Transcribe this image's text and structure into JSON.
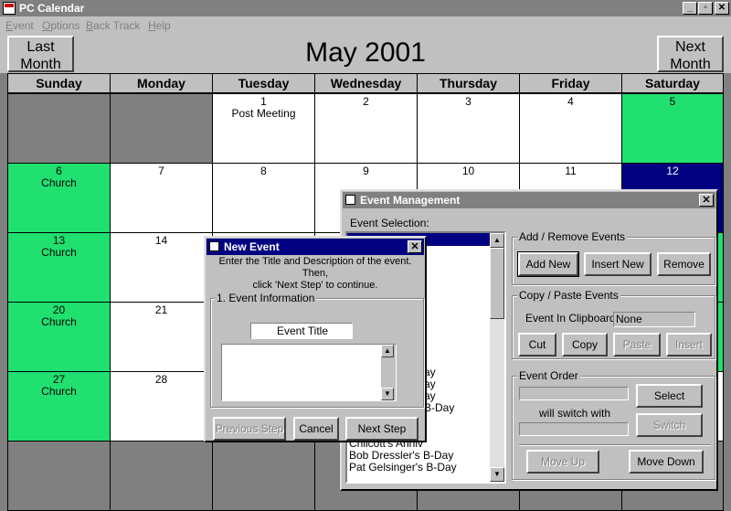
{
  "app": {
    "title": "PC Calendar"
  },
  "window_controls": [
    "_",
    "▫",
    "✕"
  ],
  "menu": [
    "Event",
    "Options",
    "Back Track",
    "Help"
  ],
  "header": {
    "prev_line1": "Last",
    "prev_line2": "Month",
    "next_line1": "Next",
    "next_line2": "Month",
    "month_title": "May 2001"
  },
  "days": [
    "Sunday",
    "Monday",
    "Tuesday",
    "Wednesday",
    "Thursday",
    "Friday",
    "Saturday"
  ],
  "weeks": [
    [
      {
        "n": "",
        "e": "",
        "s": "gray"
      },
      {
        "n": "",
        "e": "",
        "s": "gray"
      },
      {
        "n": "1",
        "e": "Post Meeting",
        "s": "white"
      },
      {
        "n": "2",
        "e": "",
        "s": "white"
      },
      {
        "n": "3",
        "e": "",
        "s": "white"
      },
      {
        "n": "4",
        "e": "",
        "s": "white"
      },
      {
        "n": "5",
        "e": "",
        "s": "green"
      }
    ],
    [
      {
        "n": "6",
        "e": "Church",
        "s": "green"
      },
      {
        "n": "7",
        "e": "",
        "s": "white"
      },
      {
        "n": "8",
        "e": "",
        "s": "white"
      },
      {
        "n": "9",
        "e": "",
        "s": "white"
      },
      {
        "n": "10",
        "e": "",
        "s": "white"
      },
      {
        "n": "11",
        "e": "",
        "s": "white"
      },
      {
        "n": "12",
        "e": "",
        "s": "blue"
      }
    ],
    [
      {
        "n": "13",
        "e": "Church",
        "s": "green"
      },
      {
        "n": "14",
        "e": "",
        "s": "white"
      },
      {
        "n": "",
        "e": "",
        "s": "white"
      },
      {
        "n": "",
        "e": "",
        "s": "white"
      },
      {
        "n": "",
        "e": "",
        "s": "white"
      },
      {
        "n": "",
        "e": "",
        "s": "white"
      },
      {
        "n": "",
        "e": "",
        "s": "green"
      }
    ],
    [
      {
        "n": "20",
        "e": "Church",
        "s": "green"
      },
      {
        "n": "21",
        "e": "",
        "s": "white"
      },
      {
        "n": "",
        "e": "",
        "s": "white"
      },
      {
        "n": "",
        "e": "",
        "s": "white"
      },
      {
        "n": "",
        "e": "",
        "s": "white"
      },
      {
        "n": "",
        "e": "",
        "s": "white"
      },
      {
        "n": "",
        "e": "",
        "s": "green"
      }
    ],
    [
      {
        "n": "27",
        "e": "Church",
        "s": "green"
      },
      {
        "n": "28",
        "e": "",
        "s": "white"
      },
      {
        "n": "",
        "e": "",
        "s": "white"
      },
      {
        "n": "",
        "e": "",
        "s": "white"
      },
      {
        "n": "",
        "e": "",
        "s": "white"
      },
      {
        "n": "",
        "e": "",
        "s": "white"
      },
      {
        "n": "",
        "e": "",
        "s": "white"
      }
    ],
    [
      {
        "n": "",
        "e": "",
        "s": "gray"
      },
      {
        "n": "",
        "e": "",
        "s": "gray"
      },
      {
        "n": "",
        "e": "",
        "s": "gray"
      },
      {
        "n": "",
        "e": "",
        "s": "gray"
      },
      {
        "n": "",
        "e": "",
        "s": "gray"
      },
      {
        "n": "",
        "e": "",
        "s": "gray"
      },
      {
        "n": "",
        "e": "",
        "s": "gray"
      }
    ]
  ],
  "event_mgmt": {
    "title": "Event Management",
    "selection_label": "Event Selection:",
    "list_items": [
      "ay",
      "ay",
      "ay",
      "B-Day",
      "",
      "",
      "Chilcott's Anniv",
      "Bob Dressler's B-Day",
      "Pat Gelsinger's B-Day"
    ],
    "add_remove_label": "Add / Remove Events",
    "add_new": "Add New",
    "insert_new": "Insert New",
    "remove": "Remove",
    "copy_paste_label": "Copy / Paste Events",
    "clipboard_label": "Event In Clipboard:",
    "clipboard_value": "None",
    "cut": "Cut",
    "copy": "Copy",
    "paste": "Paste",
    "insert": "Insert",
    "order_label": "Event Order",
    "select": "Select",
    "switch_with": "will switch with",
    "switch": "Switch",
    "move_up": "Move Up",
    "move_down": "Move Down"
  },
  "new_event": {
    "title": "New Event",
    "instructions1": "Enter the Title and Description of the event. Then,",
    "instructions2": "click 'Next Step' to continue.",
    "group_label": "1. Event Information",
    "title_field": "Event Title",
    "prev_step": "Previous Step",
    "cancel": "Cancel",
    "next_step": "Next Step"
  },
  "colors": {
    "weekend_green": "#20e070",
    "selected_blue": "#000080",
    "active_title": "#000080"
  }
}
